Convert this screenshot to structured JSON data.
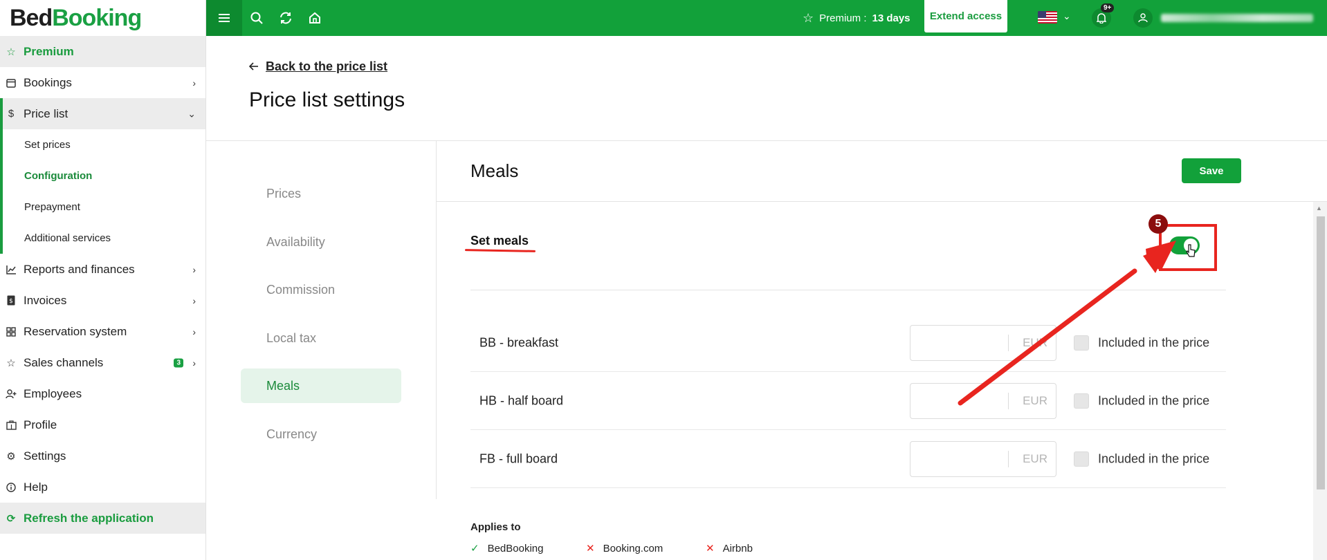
{
  "logo": {
    "part1": "Bed",
    "part2": "Booking"
  },
  "sidebar": {
    "premium": "Premium",
    "items": [
      {
        "label": "Bookings"
      },
      {
        "label": "Price list"
      },
      {
        "label": "Reports and finances"
      },
      {
        "label": "Invoices"
      },
      {
        "label": "Reservation system"
      },
      {
        "label": "Sales channels",
        "badge": "3"
      },
      {
        "label": "Employees"
      },
      {
        "label": "Profile"
      },
      {
        "label": "Settings"
      },
      {
        "label": "Help"
      }
    ],
    "sub_items": [
      "Set prices",
      "Configuration",
      "Prepayment",
      "Additional services"
    ],
    "refresh": "Refresh the application"
  },
  "topbar": {
    "premium_label": "Premium :",
    "premium_days": "13 days",
    "extend": "Extend access",
    "notif_badge": "9+"
  },
  "page": {
    "back": "Back to the price list",
    "title": "Price list settings"
  },
  "tabs": [
    "Prices",
    "Availability",
    "Commission",
    "Local tax",
    "Meals",
    "Currency"
  ],
  "meals": {
    "heading": "Meals",
    "save": "Save",
    "set_meals": "Set meals",
    "step_number": "5",
    "toggle_on": true,
    "rows": [
      {
        "label": "BB - breakfast",
        "currency": "EUR",
        "included": "Included in the price"
      },
      {
        "label": "HB - half board",
        "currency": "EUR",
        "included": "Included in the price"
      },
      {
        "label": "FB - full board",
        "currency": "EUR",
        "included": "Included in the price"
      }
    ],
    "applies_to": "Applies to",
    "channels": [
      {
        "name": "BedBooking",
        "mark": "✓",
        "color": "#1aa043"
      },
      {
        "name": "Booking.com",
        "mark": "✕",
        "color": "#e8251f"
      },
      {
        "name": "Airbnb",
        "mark": "✕",
        "color": "#e8251f"
      }
    ]
  },
  "colors": {
    "brand_green": "#12a13a",
    "annotation_red": "#e8251f"
  }
}
